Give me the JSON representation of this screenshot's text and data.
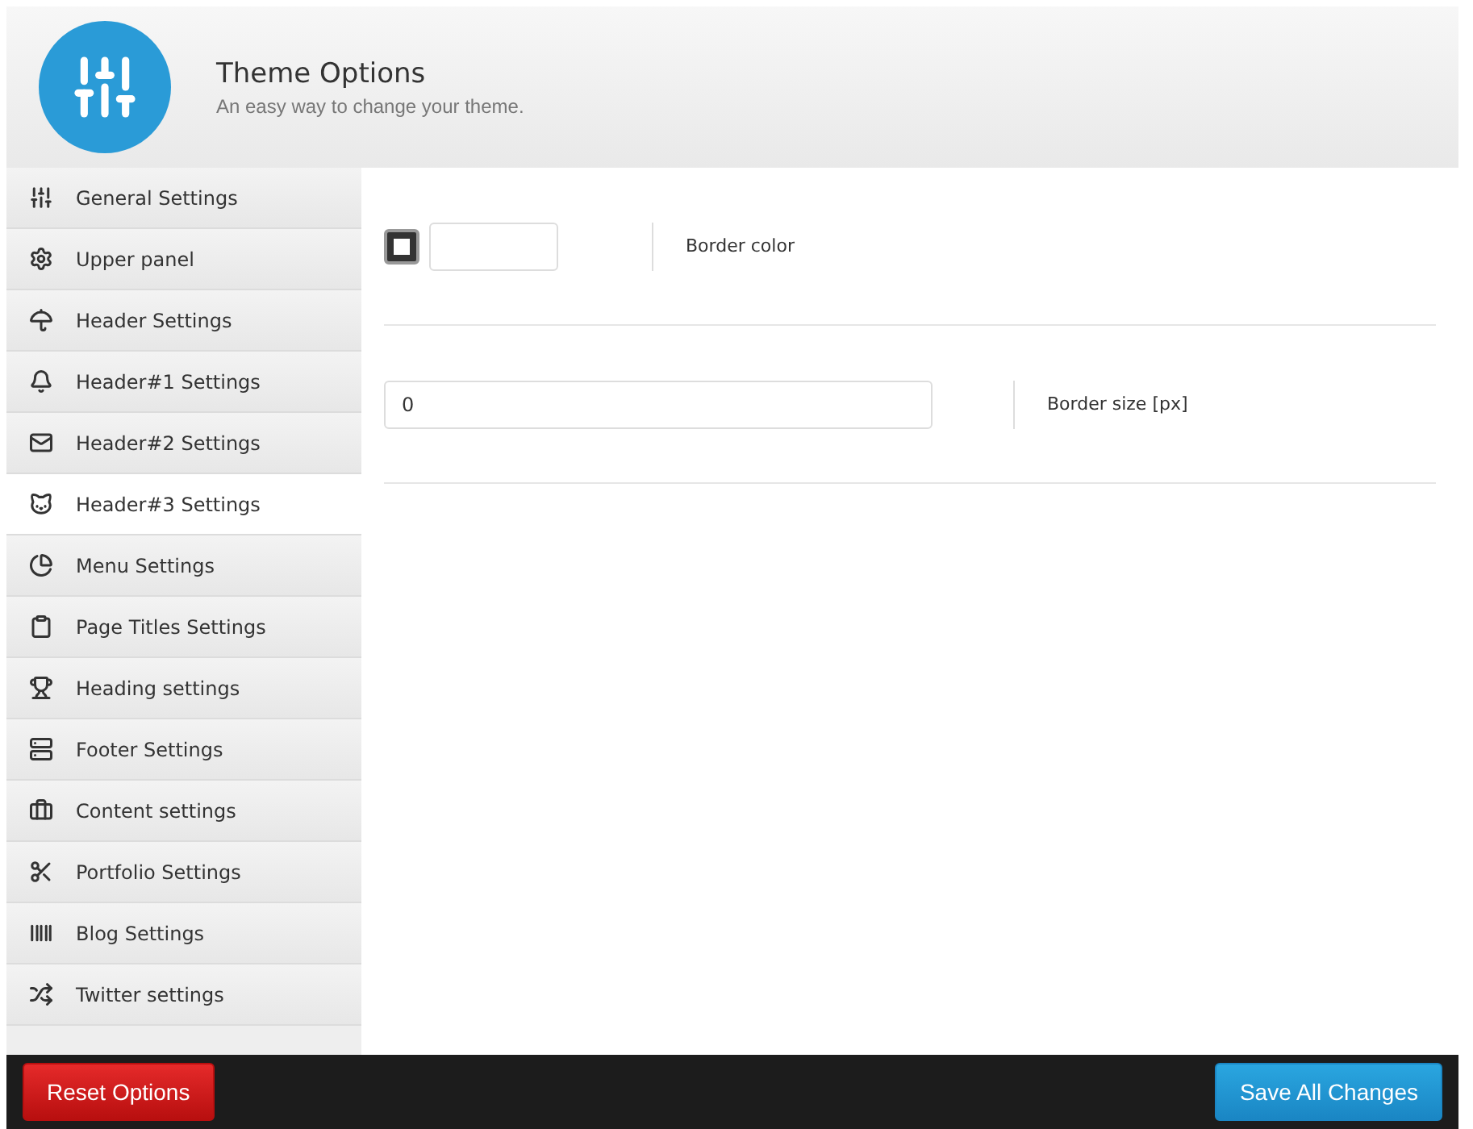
{
  "header": {
    "title": "Theme Options",
    "subtitle": "An easy way to change your theme."
  },
  "sidebar": {
    "items": [
      {
        "label": "General Settings",
        "selected": false
      },
      {
        "label": "Upper panel",
        "selected": false
      },
      {
        "label": "Header Settings",
        "selected": false
      },
      {
        "label": "Header#1 Settings",
        "selected": false
      },
      {
        "label": "Header#2 Settings",
        "selected": false
      },
      {
        "label": "Header#3 Settings",
        "selected": true
      },
      {
        "label": "Menu Settings",
        "selected": false
      },
      {
        "label": "Page Titles Settings",
        "selected": false
      },
      {
        "label": "Heading settings",
        "selected": false
      },
      {
        "label": "Footer Settings",
        "selected": false
      },
      {
        "label": "Content settings",
        "selected": false
      },
      {
        "label": "Portfolio Settings",
        "selected": false
      },
      {
        "label": "Blog Settings",
        "selected": false
      },
      {
        "label": "Twitter settings",
        "selected": false
      }
    ]
  },
  "options": [
    {
      "kind": "color",
      "label": "Border color"
    },
    {
      "kind": "text",
      "value": "0",
      "label": "Border size [px]"
    }
  ],
  "footer": {
    "reset": "Reset Options",
    "save": "Save All Changes"
  }
}
